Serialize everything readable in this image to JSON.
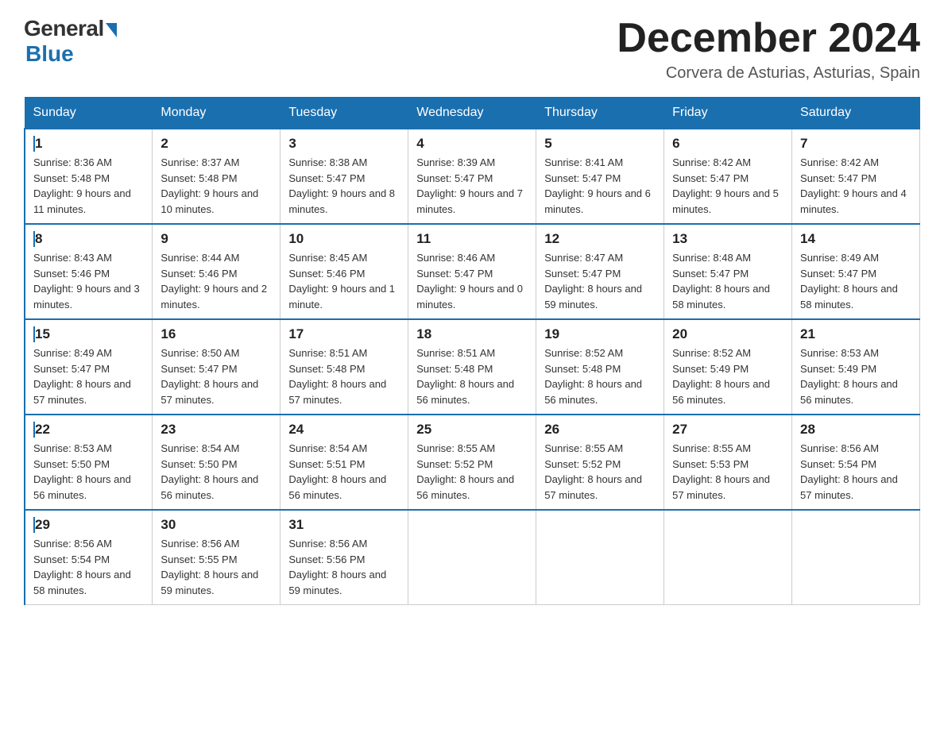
{
  "logo": {
    "general": "General",
    "blue": "Blue"
  },
  "header": {
    "month_year": "December 2024",
    "location": "Corvera de Asturias, Asturias, Spain"
  },
  "weekdays": [
    "Sunday",
    "Monday",
    "Tuesday",
    "Wednesday",
    "Thursday",
    "Friday",
    "Saturday"
  ],
  "weeks": [
    [
      {
        "day": "1",
        "sunrise": "8:36 AM",
        "sunset": "5:48 PM",
        "daylight": "9 hours and 11 minutes."
      },
      {
        "day": "2",
        "sunrise": "8:37 AM",
        "sunset": "5:48 PM",
        "daylight": "9 hours and 10 minutes."
      },
      {
        "day": "3",
        "sunrise": "8:38 AM",
        "sunset": "5:47 PM",
        "daylight": "9 hours and 8 minutes."
      },
      {
        "day": "4",
        "sunrise": "8:39 AM",
        "sunset": "5:47 PM",
        "daylight": "9 hours and 7 minutes."
      },
      {
        "day": "5",
        "sunrise": "8:41 AM",
        "sunset": "5:47 PM",
        "daylight": "9 hours and 6 minutes."
      },
      {
        "day": "6",
        "sunrise": "8:42 AM",
        "sunset": "5:47 PM",
        "daylight": "9 hours and 5 minutes."
      },
      {
        "day": "7",
        "sunrise": "8:42 AM",
        "sunset": "5:47 PM",
        "daylight": "9 hours and 4 minutes."
      }
    ],
    [
      {
        "day": "8",
        "sunrise": "8:43 AM",
        "sunset": "5:46 PM",
        "daylight": "9 hours and 3 minutes."
      },
      {
        "day": "9",
        "sunrise": "8:44 AM",
        "sunset": "5:46 PM",
        "daylight": "9 hours and 2 minutes."
      },
      {
        "day": "10",
        "sunrise": "8:45 AM",
        "sunset": "5:46 PM",
        "daylight": "9 hours and 1 minute."
      },
      {
        "day": "11",
        "sunrise": "8:46 AM",
        "sunset": "5:47 PM",
        "daylight": "9 hours and 0 minutes."
      },
      {
        "day": "12",
        "sunrise": "8:47 AM",
        "sunset": "5:47 PM",
        "daylight": "8 hours and 59 minutes."
      },
      {
        "day": "13",
        "sunrise": "8:48 AM",
        "sunset": "5:47 PM",
        "daylight": "8 hours and 58 minutes."
      },
      {
        "day": "14",
        "sunrise": "8:49 AM",
        "sunset": "5:47 PM",
        "daylight": "8 hours and 58 minutes."
      }
    ],
    [
      {
        "day": "15",
        "sunrise": "8:49 AM",
        "sunset": "5:47 PM",
        "daylight": "8 hours and 57 minutes."
      },
      {
        "day": "16",
        "sunrise": "8:50 AM",
        "sunset": "5:47 PM",
        "daylight": "8 hours and 57 minutes."
      },
      {
        "day": "17",
        "sunrise": "8:51 AM",
        "sunset": "5:48 PM",
        "daylight": "8 hours and 57 minutes."
      },
      {
        "day": "18",
        "sunrise": "8:51 AM",
        "sunset": "5:48 PM",
        "daylight": "8 hours and 56 minutes."
      },
      {
        "day": "19",
        "sunrise": "8:52 AM",
        "sunset": "5:48 PM",
        "daylight": "8 hours and 56 minutes."
      },
      {
        "day": "20",
        "sunrise": "8:52 AM",
        "sunset": "5:49 PM",
        "daylight": "8 hours and 56 minutes."
      },
      {
        "day": "21",
        "sunrise": "8:53 AM",
        "sunset": "5:49 PM",
        "daylight": "8 hours and 56 minutes."
      }
    ],
    [
      {
        "day": "22",
        "sunrise": "8:53 AM",
        "sunset": "5:50 PM",
        "daylight": "8 hours and 56 minutes."
      },
      {
        "day": "23",
        "sunrise": "8:54 AM",
        "sunset": "5:50 PM",
        "daylight": "8 hours and 56 minutes."
      },
      {
        "day": "24",
        "sunrise": "8:54 AM",
        "sunset": "5:51 PM",
        "daylight": "8 hours and 56 minutes."
      },
      {
        "day": "25",
        "sunrise": "8:55 AM",
        "sunset": "5:52 PM",
        "daylight": "8 hours and 56 minutes."
      },
      {
        "day": "26",
        "sunrise": "8:55 AM",
        "sunset": "5:52 PM",
        "daylight": "8 hours and 57 minutes."
      },
      {
        "day": "27",
        "sunrise": "8:55 AM",
        "sunset": "5:53 PM",
        "daylight": "8 hours and 57 minutes."
      },
      {
        "day": "28",
        "sunrise": "8:56 AM",
        "sunset": "5:54 PM",
        "daylight": "8 hours and 57 minutes."
      }
    ],
    [
      {
        "day": "29",
        "sunrise": "8:56 AM",
        "sunset": "5:54 PM",
        "daylight": "8 hours and 58 minutes."
      },
      {
        "day": "30",
        "sunrise": "8:56 AM",
        "sunset": "5:55 PM",
        "daylight": "8 hours and 59 minutes."
      },
      {
        "day": "31",
        "sunrise": "8:56 AM",
        "sunset": "5:56 PM",
        "daylight": "8 hours and 59 minutes."
      },
      null,
      null,
      null,
      null
    ]
  ]
}
